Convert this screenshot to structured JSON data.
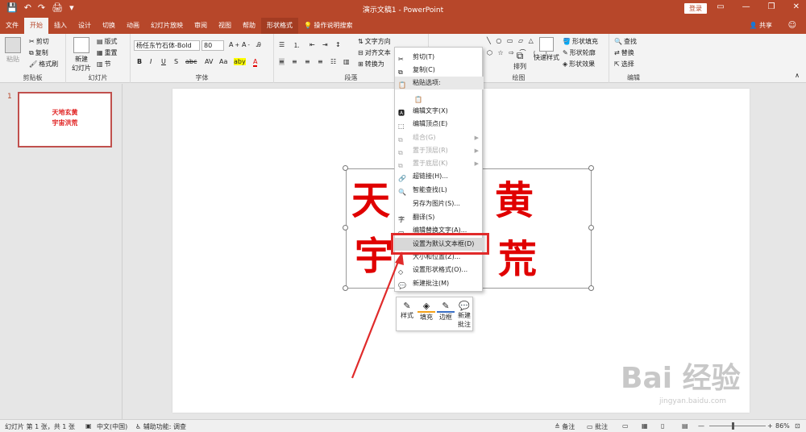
{
  "titlebar": {
    "title": "演示文稿1  -  PowerPoint",
    "login": "登录",
    "qat": [
      "💾",
      "↶",
      "↷",
      "🖨",
      "▾"
    ],
    "window": [
      "▭",
      "—",
      "❐",
      "✕"
    ]
  },
  "tabs": {
    "items": [
      "文件",
      "开始",
      "插入",
      "设计",
      "切换",
      "动画",
      "幻灯片放映",
      "审阅",
      "视图",
      "帮助",
      "形状格式"
    ],
    "search": "操作说明搜索",
    "share": "共享",
    "active": "开始"
  },
  "ribbon": {
    "clipboard": {
      "label": "剪贴板",
      "paste": "粘贴",
      "cut": "剪切",
      "copy": "复制",
      "format_painter": "格式刷"
    },
    "slides": {
      "label": "幻灯片",
      "new_slide": "新建\n幻灯片",
      "layout": "版式",
      "reset": "重置",
      "section": "节"
    },
    "font": {
      "label": "字体",
      "font_name": "杨任东竹石体-Bold",
      "font_size": "80",
      "bold": "B",
      "italic": "I",
      "underline": "U",
      "strike": "S",
      "shadow": "abc",
      "spacing": "AV",
      "case": "Aa",
      "highlight": "aby",
      "color": "A"
    },
    "paragraph": {
      "label": "段落",
      "text_direction": "文字方向",
      "align_text": "对齐文本",
      "convert": "转换为"
    },
    "drawing": {
      "label": "绘图",
      "arrange": "排列",
      "quick_styles": "快速样式",
      "fill": "形状填充",
      "outline": "形状轮廓",
      "effects": "形状效果"
    },
    "editing": {
      "label": "编辑",
      "find": "查找",
      "replace": "替换",
      "select": "选择"
    }
  },
  "slide_panel": {
    "number": "1",
    "line1": "天地玄黄",
    "line2": "宇宙洪荒"
  },
  "slide": {
    "chars": [
      "天",
      "黄",
      "宇",
      "荒"
    ]
  },
  "context_menu": {
    "items": [
      {
        "label": "剪切(T)",
        "icon": "scissors-icon",
        "disabled": false
      },
      {
        "label": "复制(C)",
        "icon": "copy-icon",
        "disabled": false
      },
      {
        "label": "粘贴选项:",
        "icon": "paste-icon",
        "disabled": false,
        "section": true
      },
      {
        "label": "",
        "icon": "paste-option-icon",
        "disabled": true
      },
      {
        "label": "编辑文字(X)",
        "icon": "edit-text-icon",
        "disabled": false
      },
      {
        "label": "编辑顶点(E)",
        "icon": "edit-points-icon",
        "disabled": false
      },
      {
        "label": "组合(G)",
        "icon": "group-icon",
        "disabled": true,
        "submenu": true
      },
      {
        "label": "置于顶层(R)",
        "icon": "bring-front-icon",
        "disabled": true,
        "submenu": true
      },
      {
        "label": "置于底层(K)",
        "icon": "send-back-icon",
        "disabled": true,
        "submenu": true
      },
      {
        "label": "超链接(H)...",
        "icon": "hyperlink-icon",
        "disabled": false
      },
      {
        "label": "智能查找(L)",
        "icon": "smart-lookup-icon",
        "disabled": false
      },
      {
        "label": "另存为图片(S)...",
        "icon": "",
        "disabled": false
      },
      {
        "label": "翻译(S)",
        "icon": "translate-icon",
        "disabled": false
      },
      {
        "label": "编辑替换文字(A)...",
        "icon": "alt-text-icon",
        "disabled": false
      },
      {
        "label": "设置为默认文本框(D)",
        "icon": "",
        "disabled": false,
        "highlight": true
      },
      {
        "label": "大小和位置(Z)...",
        "icon": "size-position-icon",
        "disabled": false
      },
      {
        "label": "设置形状格式(O)...",
        "icon": "format-shape-icon",
        "disabled": false
      },
      {
        "label": "新建批注(M)",
        "icon": "comment-icon",
        "disabled": false
      }
    ]
  },
  "mini_toolbar": {
    "style": "样式",
    "fill": "填充",
    "outline": "边框",
    "comment": "新建\n批注"
  },
  "statusbar": {
    "slide_info": "幻灯片 第 1 张，共 1 张",
    "language": "中文(中国)",
    "accessibility": "辅助功能: 调查",
    "notes": "备注",
    "comments": "批注",
    "zoom": "86%"
  },
  "watermark": {
    "brand": "Bai  经验",
    "url": "jingyan.baidu.com"
  },
  "colors": {
    "accent": "#b7472a",
    "highlight_box": "#e02a2a",
    "slide_text": "#e00000"
  }
}
